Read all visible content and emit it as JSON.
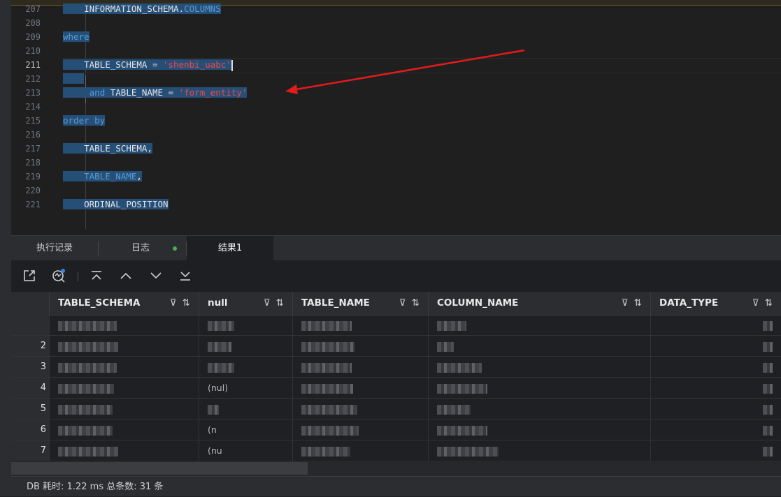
{
  "editor": {
    "lines": [
      {
        "num": "207",
        "active": false
      },
      {
        "num": "208",
        "active": false
      },
      {
        "num": "209",
        "active": false
      },
      {
        "num": "210",
        "active": false
      },
      {
        "num": "211",
        "active": true
      },
      {
        "num": "212",
        "active": false
      },
      {
        "num": "213",
        "active": false
      },
      {
        "num": "214",
        "active": false
      },
      {
        "num": "215",
        "active": false
      },
      {
        "num": "216",
        "active": false
      },
      {
        "num": "217",
        "active": false
      },
      {
        "num": "218",
        "active": false
      },
      {
        "num": "219",
        "active": false
      },
      {
        "num": "220",
        "active": false
      },
      {
        "num": "221",
        "active": false
      }
    ],
    "code": {
      "l207_a": "INFORMATION_SCHEMA.",
      "l207_b": "COLUMNS",
      "l209": "where",
      "l211_a": "TABLE_SCHEMA",
      "l211_b": " = ",
      "l211_c": "'shenbi_uabc'",
      "l213_a": "and",
      "l213_b": " TABLE_NAME",
      "l213_c": " = ",
      "l213_d": "'form_entity'",
      "l215": "order by",
      "l217": "TABLE_SCHEMA,",
      "l219_a": "TABLE_NAME",
      "l219_b": ",",
      "l221": "ORDINAL_POSITION"
    },
    "annotation_color": "#e21b1b"
  },
  "tabs": [
    {
      "label": "执行记录"
    },
    {
      "label": "日志"
    },
    {
      "label": "结果1"
    }
  ],
  "toolbar": {
    "icons": [
      "export-icon",
      "ai-query-icon",
      "first-page-icon",
      "previous-page-icon",
      "next-page-icon",
      "last-page-icon"
    ]
  },
  "grid": {
    "columns": [
      {
        "label": "TABLE_SCHEMA"
      },
      {
        "label": "null"
      },
      {
        "label": "TABLE_NAME"
      },
      {
        "label": "COLUMN_NAME"
      },
      {
        "label": "DATA_TYPE"
      }
    ],
    "rows": [
      {
        "num": "",
        "null_text": ""
      },
      {
        "num": "2",
        "null_text": ""
      },
      {
        "num": "3",
        "null_text": ""
      },
      {
        "num": "4",
        "null_text": "(nul)"
      },
      {
        "num": "5",
        "null_text": ""
      },
      {
        "num": "6",
        "null_text": "(n"
      },
      {
        "num": "7",
        "null_text": "(nu"
      }
    ]
  },
  "status": {
    "text": "DB 耗时: 1.22 ms  总条数: 31 条"
  }
}
